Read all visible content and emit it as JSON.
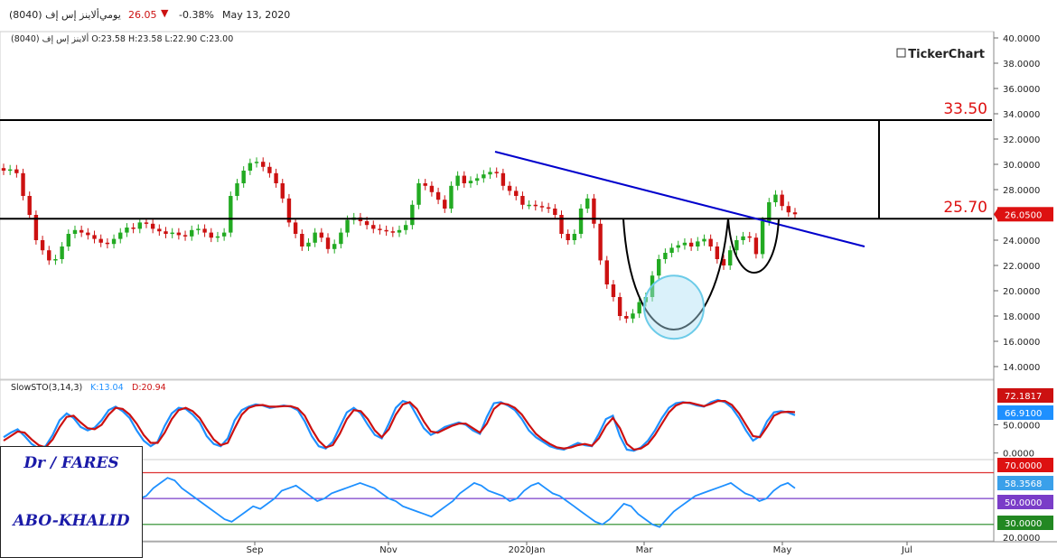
{
  "header": {
    "title": "ألاينز إس إف (8040)",
    "period": "يومي",
    "price": "26.05",
    "change": "-0.38%",
    "date": "May 13, 2020"
  },
  "ohlc_line": "ألاينز إس إف (8040) O:23.58 H:23.58 L:22.90 C:23.00",
  "brand": "TickerChart",
  "author": {
    "line1": "Dr / FARES",
    "line2": "ABO-KHALID"
  },
  "colors": {
    "up": "#22aa22",
    "down": "#cc1111",
    "trend": "#0000cc",
    "circle": "#aee0f5",
    "k": "#1e90ff",
    "d": "#cc1111",
    "rsi": "#1e90ff"
  },
  "chart_data": [
    {
      "type": "candlestick",
      "yticks": [
        "40.0000",
        "38.0000",
        "36.0000",
        "34.0000",
        "32.0000",
        "30.0000",
        "28.0000",
        "26.0000",
        "24.0000",
        "22.0000",
        "20.0000",
        "18.0000",
        "16.0000",
        "14.0000"
      ],
      "ylim": [
        13,
        40.5
      ],
      "xticks": [
        "Sep",
        "Nov",
        "2020Jan",
        "Mar",
        "May",
        "Jul"
      ],
      "levels": [
        {
          "label": "33.50",
          "value": 33.5
        },
        {
          "label": "25.70",
          "value": 25.7
        }
      ],
      "last_price_label": "26.0500",
      "last_price": 26.05,
      "close_series": [
        29.5,
        29.6,
        29.3,
        27.5,
        26,
        24,
        23.2,
        22.4,
        22.5,
        23.5,
        24.5,
        24.8,
        24.6,
        24.4,
        24.1,
        23.8,
        23.7,
        24.1,
        24.6,
        25,
        24.9,
        25.4,
        25.3,
        24.9,
        24.7,
        24.5,
        24.6,
        24.4,
        24.3,
        24.8,
        24.9,
        24.6,
        24.2,
        24.3,
        24.6,
        27.5,
        28.5,
        29.5,
        30.1,
        30.2,
        29.8,
        29.3,
        28.5,
        27.3,
        25.4,
        24.5,
        23.5,
        23.8,
        24.6,
        24.2,
        23.3,
        23.7,
        24.6,
        25.6,
        25.8,
        25.5,
        25.2,
        24.9,
        24.8,
        24.7,
        24.6,
        24.8,
        25.2,
        26.8,
        28.5,
        28.3,
        27.8,
        27.2,
        26.5,
        28.3,
        29.1,
        28.5,
        28.7,
        28.9,
        29.2,
        29.4,
        29.3,
        28.3,
        27.9,
        27.5,
        26.8,
        26.8,
        26.7,
        26.6,
        26.5,
        26.0,
        24.5,
        24.0,
        24.5,
        26.5,
        27.3,
        25.3,
        22.4,
        20.5,
        19.5,
        18.0,
        17.8,
        18.2,
        19.1,
        19.5,
        21.2,
        22.5,
        23.0,
        23.4,
        23.6,
        23.8,
        23.5,
        23.9,
        24.1,
        23.5,
        22.5,
        22.0,
        23.2,
        24.0,
        24.3,
        24.2,
        22.9,
        25.5,
        27.0,
        27.6,
        26.7,
        26.2,
        26.05
      ],
      "up_close_indices_note": "candles colored green when close >= previous close",
      "annotation": "cup and handle pattern with descending trendline breakout; target 33.50"
    },
    {
      "type": "line",
      "title": "SlowSTO(3,14,3)",
      "k_label": "K:13.04",
      "d_label": "D:20.94",
      "yticks": [
        "50.0000",
        "0.0000"
      ],
      "ylim": [
        -10,
        105
      ],
      "last_labels": [
        "72.1817",
        "66.9100"
      ],
      "series": [
        {
          "name": "K",
          "values": [
            28,
            36,
            42,
            30,
            16,
            8,
            12,
            32,
            58,
            70,
            62,
            46,
            40,
            45,
            58,
            76,
            82,
            74,
            62,
            40,
            22,
            12,
            20,
            48,
            70,
            80,
            78,
            68,
            54,
            30,
            16,
            12,
            26,
            58,
            76,
            82,
            86,
            84,
            80,
            82,
            84,
            82,
            76,
            56,
            30,
            12,
            8,
            20,
            46,
            72,
            80,
            70,
            50,
            32,
            26,
            52,
            80,
            92,
            88,
            66,
            44,
            32,
            38,
            46,
            50,
            54,
            50,
            40,
            34,
            64,
            88,
            90,
            84,
            76,
            60,
            40,
            28,
            20,
            12,
            8,
            6,
            12,
            18,
            14,
            12,
            34,
            60,
            66,
            30,
            6,
            4,
            10,
            22,
            40,
            62,
            80,
            88,
            90,
            88,
            84,
            82,
            90,
            94,
            90,
            80,
            62,
            40,
            22,
            30,
            56,
            72,
            74,
            72,
            67
          ]
        },
        {
          "name": "D",
          "values": [
            22,
            30,
            38,
            36,
            24,
            14,
            10,
            24,
            46,
            64,
            66,
            54,
            44,
            42,
            50,
            68,
            80,
            78,
            68,
            52,
            32,
            18,
            18,
            36,
            60,
            76,
            80,
            74,
            62,
            42,
            24,
            14,
            18,
            44,
            68,
            80,
            84,
            85,
            82,
            82,
            83,
            83,
            79,
            66,
            42,
            22,
            10,
            14,
            34,
            60,
            76,
            74,
            60,
            40,
            28,
            42,
            68,
            86,
            90,
            78,
            56,
            38,
            36,
            42,
            48,
            52,
            52,
            44,
            36,
            52,
            78,
            88,
            86,
            80,
            68,
            50,
            34,
            24,
            16,
            10,
            8,
            10,
            14,
            16,
            13,
            26,
            48,
            62,
            44,
            16,
            6,
            8,
            16,
            32,
            52,
            72,
            84,
            89,
            89,
            86,
            83,
            87,
            92,
            92,
            85,
            70,
            50,
            30,
            28,
            46,
            66,
            72,
            73,
            72.18
          ]
        }
      ]
    },
    {
      "type": "line",
      "title": "RSI",
      "levels": [
        70,
        50,
        30
      ],
      "yticks": [
        "20.0000"
      ],
      "ylim": [
        18,
        78
      ],
      "last_labels": [
        "70.0000",
        "58.3568",
        "50.0000",
        "30.0000"
      ],
      "series": [
        {
          "name": "RSI",
          "values": [
            56,
            60,
            58,
            62,
            54,
            48,
            44,
            40,
            46,
            52,
            54,
            50,
            48,
            46,
            50,
            52,
            50,
            46,
            48,
            50,
            52,
            58,
            62,
            66,
            64,
            58,
            54,
            50,
            46,
            42,
            38,
            34,
            32,
            36,
            40,
            44,
            42,
            46,
            50,
            56,
            58,
            60,
            56,
            52,
            48,
            50,
            54,
            56,
            58,
            60,
            62,
            60,
            58,
            54,
            50,
            48,
            44,
            42,
            40,
            38,
            36,
            40,
            44,
            48,
            54,
            58,
            62,
            60,
            56,
            54,
            52,
            48,
            50,
            56,
            60,
            62,
            58,
            54,
            52,
            48,
            44,
            40,
            36,
            32,
            30,
            34,
            40,
            46,
            44,
            38,
            34,
            30,
            28,
            34,
            40,
            44,
            48,
            52,
            54,
            56,
            58,
            60,
            62,
            58,
            54,
            52,
            48,
            50,
            56,
            60,
            62,
            58
          ]
        }
      ]
    }
  ]
}
